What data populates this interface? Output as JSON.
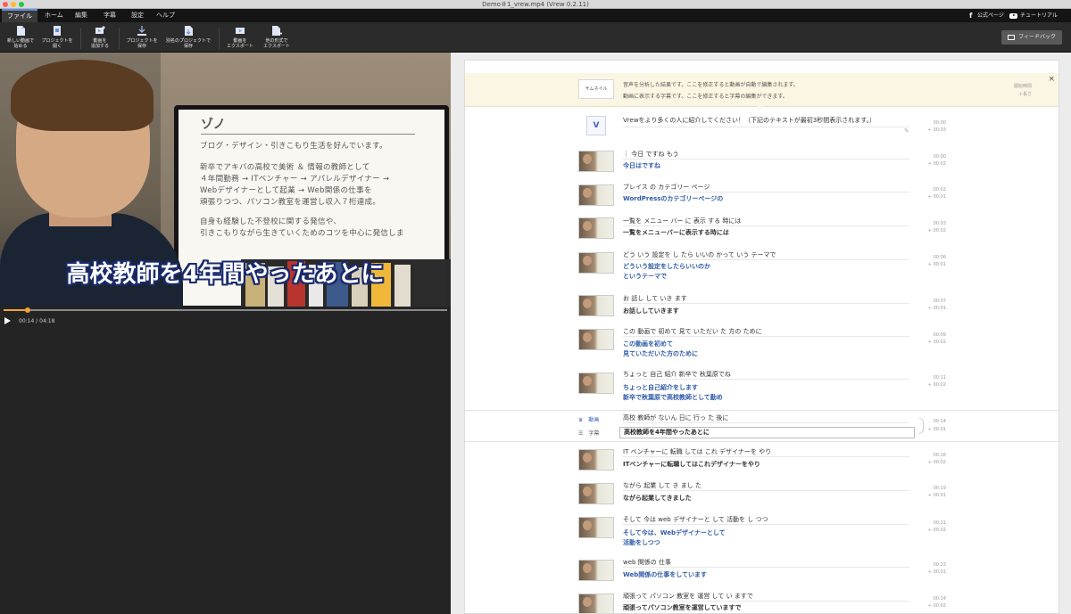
{
  "window": {
    "title": "Demo＃1_vrew.mp4 (Vrew 0.2.11)"
  },
  "menu": {
    "items": [
      "ファイル",
      "ホーム",
      "編集",
      "字幕",
      "設定",
      "ヘルプ"
    ],
    "right": {
      "official": "公式ページ",
      "tutorial": "チュートリアル"
    }
  },
  "toolbar": {
    "new_video": "新しい動画で\n始める",
    "open_project": "プロジェクトを\n開く",
    "add_video": "動画を\n追加する",
    "save_project": "プロジェクトを\n保存",
    "save_as": "別名のプロジェクトで\n保存",
    "export_video": "動画を\nエクスポート",
    "export_other": "他の形式で\nエクスポート",
    "feedback": "フィードバック"
  },
  "video": {
    "subtitle": "高校教師を4年間やったあとに",
    "screen_title": "ゾノ",
    "screen_lines": [
      "ブログ・デザイン・引きこもり生活を好んでいます。",
      "新卒でアキバの高校で美術 ＆ 情報の教師として",
      "４年間勤務 → ITベンチャー → アパレルデザイナー →",
      "Webデザイナーとして起業 → Web関係の仕事を",
      "頑張りつつ、パソコン教室を運営し収入７桁達成。",
      "自身も経験した不登校に関する発信や、",
      "引きこもりながら生きていくためのコツを中心に発信しま"
    ]
  },
  "player": {
    "timecode": "00:14 / 04:18",
    "progress": 0.054
  },
  "editor": {
    "info": {
      "thumb_label": "サムネイル",
      "line1": "音声を分析した結果です。ここを修正すると動画が自動で編集されます。",
      "line2": "動画に表示する字幕です。ここを修正すると字幕の編集ができます。",
      "side1": "開始時間",
      "side2": "＋長さ",
      "close": "×"
    },
    "intro": {
      "icon": "V",
      "text": "Vrewをより多くの人に紹介してください！（下記のテキストが最初3秒間表示されます。）",
      "time": "00:00",
      "dur": "+ 00:03"
    },
    "rows": [
      {
        "src": "⋮ 今日 ですね もう",
        "cap": [
          "今日はですね"
        ],
        "time": "00:00",
        "dur": "+ 00:02"
      },
      {
        "src": "ブレイス の カテゴリー ページ",
        "cap": [
          "WordPressのカテゴリーページの"
        ],
        "time": "00:02",
        "dur": "+ 00:01"
      },
      {
        "src": "一覧を メニュー バー に 表示 する 時には",
        "cap": [
          "一覧をメニューバーに表示する時には"
        ],
        "time": "00:03",
        "dur": "+ 00:02",
        "dark": true
      },
      {
        "src": "どう いう 設定を し たら いいの かって いう テーマで",
        "cap": [
          "どういう設定をしたらいいのか",
          "というテーマで"
        ],
        "time": "00:06",
        "dur": "+ 00:01"
      },
      {
        "src": "お 話し して いき ます",
        "cap": [
          "お話ししていきます"
        ],
        "time": "00:07",
        "dur": "+ 00:01",
        "dark": true
      },
      {
        "src": "この 動画で 初めて 見て いただい た 方の ために",
        "cap": [
          "この動画を初めて",
          "見ていただいた方のために"
        ],
        "time": "00:09",
        "dur": "+ 00:02"
      },
      {
        "src": "ちょっと 自己 紹介 新卒で 秋葉原でね",
        "cap": [
          "ちょっと自己紹介をします",
          "新卒で秋葉原で高校教師として勤め"
        ],
        "time": "00:11",
        "dur": "+ 00:02"
      }
    ],
    "selected": {
      "tag_video": "動画",
      "tag_caption": "字幕",
      "src": "高校 教師が ないん 日に 行っ た 後に",
      "cap": "高校教師を4年間やったあとに",
      "time": "00:14",
      "dur": "+ 00:01"
    },
    "rows2": [
      {
        "src": "IT ベンチャーに 転職 しては これ デザイナーを やり",
        "cap": [
          "ITベンチャーに転職してはこれデザイナーをやり"
        ],
        "time": "00:16",
        "dur": "+ 00:02",
        "dark": true
      },
      {
        "src": "ながら 起業 して き まし た",
        "cap": [
          "ながら起業してきました"
        ],
        "time": "00:19",
        "dur": "+ 00:01",
        "dark": true
      },
      {
        "src": "そして 今は web デザイナーと して 活動を し つつ",
        "cap": [
          "そして今は、Webデザイナーとして",
          "活動をしつつ"
        ],
        "time": "00:21",
        "dur": "+ 00:02"
      },
      {
        "src": "web 関係の 仕事",
        "cap": [
          "Web関係の仕事をしています"
        ],
        "time": "00:23",
        "dur": "+ 00:01"
      },
      {
        "src": "頑張って パソコン 教室を 運営 して い ますで",
        "cap": [
          "頑張ってパソコン教室を運営していますで"
        ],
        "time": "00:24",
        "dur": "+ 00:02",
        "dark": true
      }
    ]
  },
  "colors": {
    "accent": "#2f5aa8",
    "seek": "#f2a23a",
    "menubar": "#141414"
  }
}
